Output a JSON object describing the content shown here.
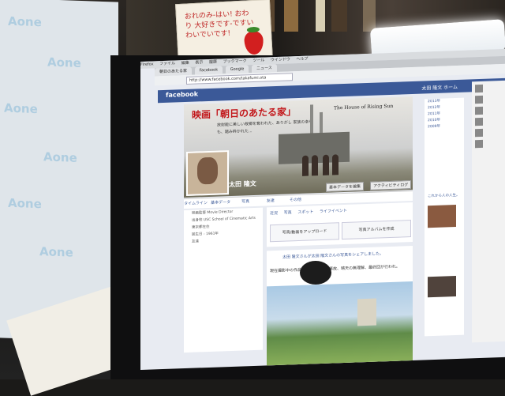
{
  "note": {
    "text": "おれのみ-はい! おわり 大好きです-ですいわいでいです!"
  },
  "paper": {
    "watermark": "Aone"
  },
  "browser": {
    "menu": [
      "Firefox",
      "ファイル",
      "編集",
      "表示",
      "履歴",
      "ブックマーク",
      "ツール",
      "ウインドウ",
      "ヘルプ"
    ],
    "tabs": [
      "朝日のあたる家",
      "Facebook",
      "Google",
      "ニュース"
    ],
    "url": "http://www.facebook.com/takafumi.ota"
  },
  "facebook": {
    "logo": "facebook",
    "nav": "太田 隆文   ホーム",
    "cover": {
      "title": "映画「朝日のあたる家」",
      "title_en": "The House of Rising Sun",
      "subtitle": "放射能に美しい故郷を奪われた、ありがし 家族の幸せも、踏み砕かれた..."
    },
    "profile_name": "太田 隆文",
    "buttons": [
      "基本データを編集",
      "アクティビティログ"
    ],
    "timeline_nav": [
      "タイムライン",
      "基本データ",
      "写真",
      "友達",
      "その他"
    ],
    "left_items": [
      "映画監督 Movie Director",
      "出身校 USC School of Cinematic Arts",
      "東京都在住",
      "誕生日 - 1961年",
      "友達"
    ],
    "status_tabs": [
      "近況",
      "写真",
      "スポット",
      "ライフイベント"
    ],
    "upload_photo": "写真/動画をアップロード",
    "create_album": "写真アルバムを作成",
    "post_header": "太田 隆文さんが太田 隆文さんの写真をシェアしました。",
    "post_body": "現在撮影中の作品。放射能、主な事故、晴天の無理解、最終回が行われ。",
    "right_links": [
      "2013年",
      "2012年",
      "2011年",
      "2010年",
      "2009年"
    ],
    "right_caption": "これから人の人生。"
  }
}
